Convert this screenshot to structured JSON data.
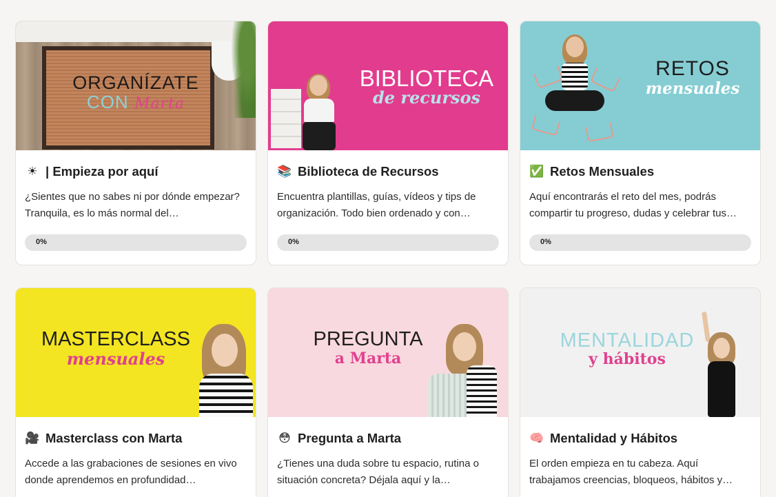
{
  "cards": [
    {
      "title": "| Empieza por aquí",
      "emoji": "☀",
      "description": "¿Sientes que no sabes ni por dónde empezar? Tranquila, es lo más normal del…",
      "progress_label": "0%",
      "progress": 0,
      "banner": {
        "line1": "ORGANÍZATE",
        "line2a": "CON",
        "line2b": "Marta"
      }
    },
    {
      "title": "Biblioteca de Recursos",
      "emoji": "📚",
      "description": "Encuentra plantillas, guías, vídeos y tips de organización. Todo bien ordenado y con…",
      "progress_label": "0%",
      "progress": 0,
      "banner": {
        "line1": "BIBLIOTECA",
        "line2": "de recursos"
      }
    },
    {
      "title": "Retos Mensuales",
      "emoji": "✅",
      "description": "Aquí encontrarás el reto del mes, podrás compartir tu progreso, dudas y celebrar tus…",
      "progress_label": "0%",
      "progress": 0,
      "banner": {
        "line1": "RETOS",
        "line2": "mensuales"
      }
    },
    {
      "title": "Masterclass con Marta",
      "emoji": "🎥",
      "description": "Accede a las grabaciones de sesiones en vivo donde aprendemos en profundidad…",
      "banner": {
        "line1": "MASTERCLASS",
        "line2": "mensuales"
      }
    },
    {
      "title": "Pregunta a Marta",
      "emoji": "😳",
      "description": "¿Tienes una duda sobre tu espacio, rutina o situación concreta? Déjala aquí y la…",
      "banner": {
        "line1": "PREGUNTA",
        "line2": "a Marta"
      }
    },
    {
      "title": "Mentalidad y Hábitos",
      "emoji": "🧠",
      "description": "El orden empieza en tu cabeza. Aquí trabajamos creencias, bloqueos, hábitos y…",
      "banner": {
        "line1": "MENTALIDAD",
        "line2": "y hábitos"
      }
    }
  ]
}
